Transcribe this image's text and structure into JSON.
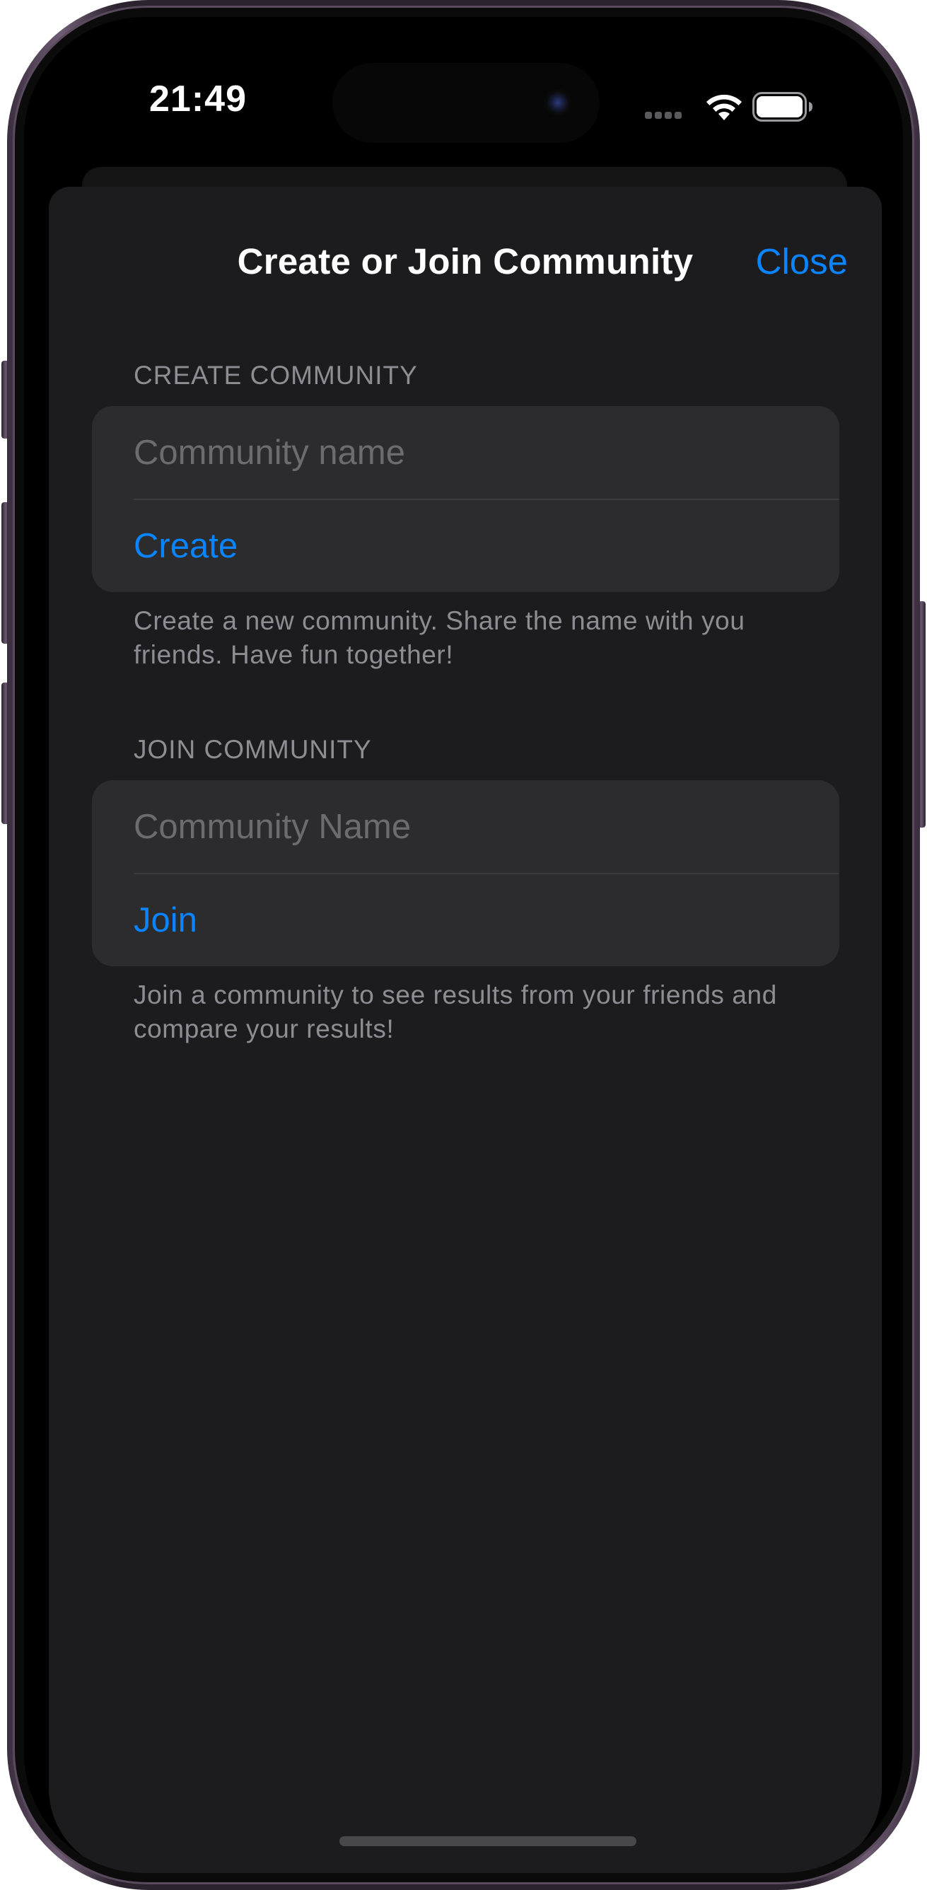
{
  "status_bar": {
    "time": "21:49"
  },
  "sheet": {
    "title": "Create or Join Community",
    "close_label": "Close"
  },
  "create_section": {
    "header": "CREATE COMMUNITY",
    "input_placeholder": "Community name",
    "action_label": "Create",
    "footer": "Create a new community. Share the name with you friends. Have fun together!"
  },
  "join_section": {
    "header": "JOIN COMMUNITY",
    "input_placeholder": "Community Name",
    "action_label": "Join",
    "footer": "Join a community to see results from your friends and compare your results!"
  },
  "colors": {
    "accent": "#0a84ff",
    "sheet_background": "#1c1c1e",
    "group_background": "#2c2c2e",
    "secondary_text": "#8d8d93"
  },
  "icons": [
    "cellular-signal-icon",
    "wifi-icon",
    "battery-icon"
  ]
}
